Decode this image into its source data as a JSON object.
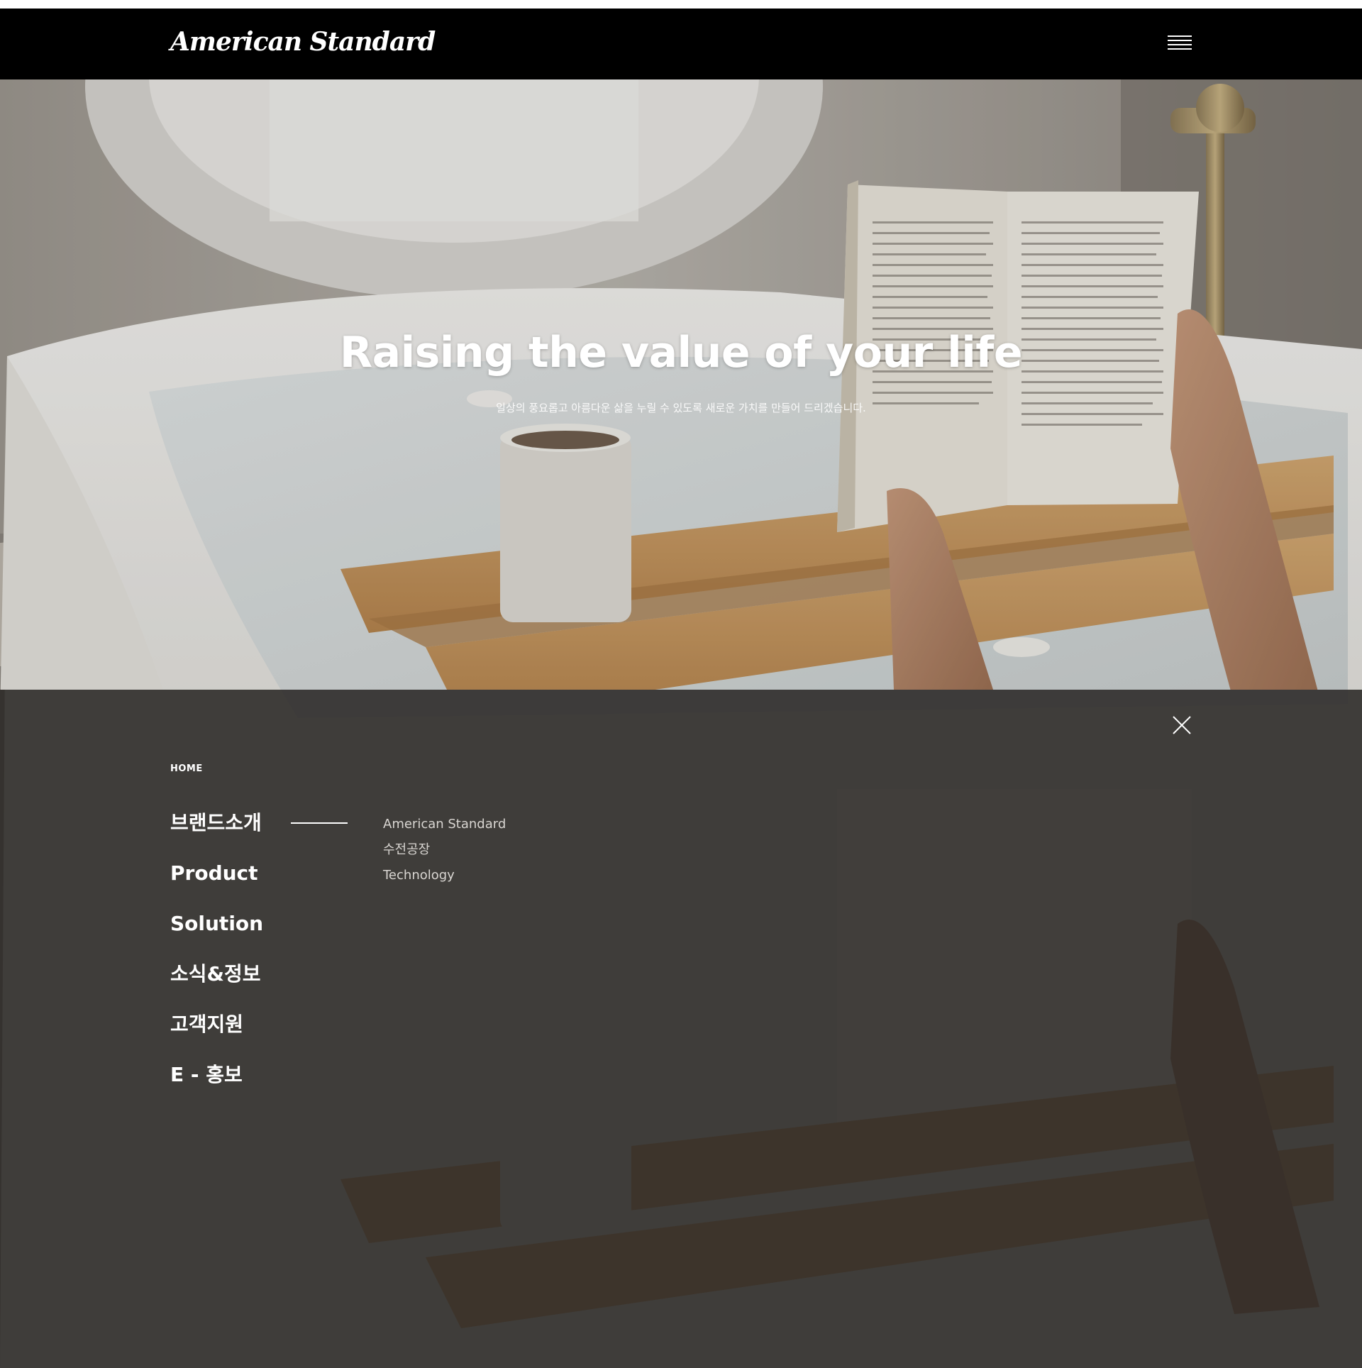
{
  "header": {
    "logo_text": "American Standard"
  },
  "hero": {
    "title": "Raising the value of your life",
    "subtitle": "일상의 풍요롭고 아름다운 삶을 누릴 수 있도록 새로운 가치를 만들어 드리겠습니다."
  },
  "menu": {
    "breadcrumb": "HOME",
    "items": [
      {
        "label": "브랜드소개"
      },
      {
        "label": "Product"
      },
      {
        "label": "Solution"
      },
      {
        "label": "소식&정보"
      },
      {
        "label": "고객지원"
      },
      {
        "label": "E - 홍보"
      }
    ],
    "active_index": 0,
    "subitems": [
      {
        "label": "American Standard"
      },
      {
        "label": "수전공장"
      },
      {
        "label": "Technology"
      }
    ]
  },
  "colors": {
    "header_bg": "#000000",
    "overlay_tint": "#262422",
    "text_primary": "#ffffff",
    "text_secondary": "#d9d6d2"
  },
  "icons": {
    "menu": "hamburger-menu-icon",
    "close": "close-icon"
  }
}
